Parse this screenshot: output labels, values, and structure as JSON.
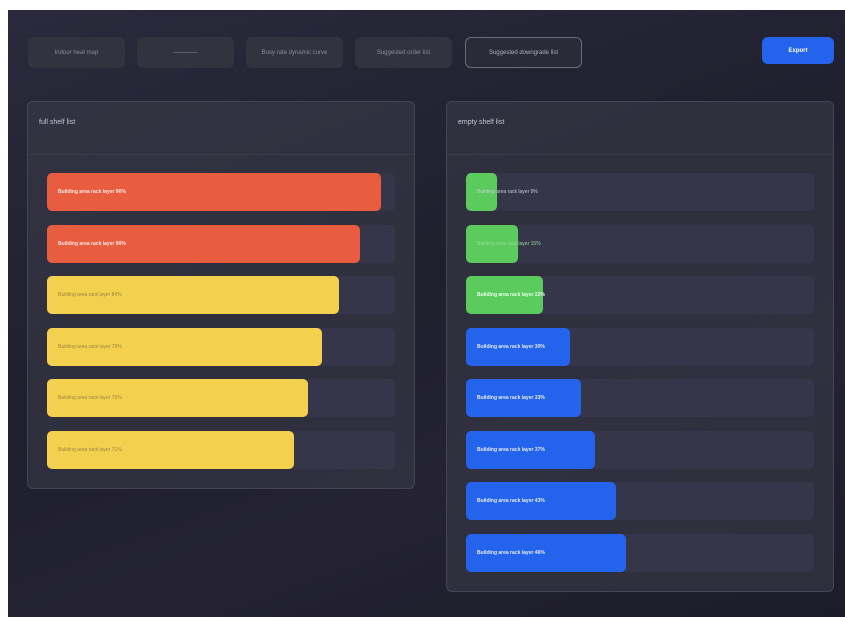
{
  "tabs": [
    {
      "label": "Indoor heat map",
      "active": false
    },
    {
      "label": "————",
      "active": false
    },
    {
      "label": "Busy rate dynamic curve",
      "active": false
    },
    {
      "label": "Suggested order list",
      "active": false
    },
    {
      "label": "Suggested downgrade list",
      "active": true
    }
  ],
  "export_label": "Export",
  "panels": {
    "full": {
      "title": "full shelf list",
      "rows": [
        {
          "label": "Building area rack layer 96%",
          "value": 96,
          "color": "#e85d3f",
          "text_color": "#ffe9e0",
          "bold": true
        },
        {
          "label": "Building area rack layer 90%",
          "value": 90,
          "color": "#e85d3f",
          "text_color": "#ffe9e0",
          "bold": true
        },
        {
          "label": "Building area rack layer 84%",
          "value": 84,
          "color": "#f4d04f",
          "text_color": "#9a8640",
          "bold": false
        },
        {
          "label": "Building area rack layer 79%",
          "value": 79,
          "color": "#f4d04f",
          "text_color": "#9a8640",
          "bold": false
        },
        {
          "label": "Building area rack layer 75%",
          "value": 75,
          "color": "#f4d04f",
          "text_color": "#9a8640",
          "bold": false
        },
        {
          "label": "Building area rack layer 71%",
          "value": 71,
          "color": "#f4d04f",
          "text_color": "#9a8640",
          "bold": false
        }
      ]
    },
    "empty": {
      "title": "empty shelf list",
      "rows": [
        {
          "label": "Building area rack layer 9%",
          "value": 9,
          "color": "#5bcb5d",
          "text_color": "#c9ccd8",
          "bold": false
        },
        {
          "label": "Building area rack layer 15%",
          "value": 15,
          "color": "#5bcb5d",
          "text_color": "#9bd89c",
          "bold": false
        },
        {
          "label": "Building area rack layer 22%",
          "value": 22,
          "color": "#5bcb5d",
          "text_color": "#eaffea",
          "bold": true
        },
        {
          "label": "Building area rack layer 30%",
          "value": 30,
          "color": "#2463eb",
          "text_color": "#e6ecff",
          "bold": true
        },
        {
          "label": "Building area rack layer 33%",
          "value": 33,
          "color": "#2463eb",
          "text_color": "#e6ecff",
          "bold": true
        },
        {
          "label": "Building area rack layer 37%",
          "value": 37,
          "color": "#2463eb",
          "text_color": "#e6ecff",
          "bold": true
        },
        {
          "label": "Building area rack layer 43%",
          "value": 43,
          "color": "#2463eb",
          "text_color": "#e6ecff",
          "bold": true
        },
        {
          "label": "Building area rack layer 46%",
          "value": 46,
          "color": "#2463eb",
          "text_color": "#e6ecff",
          "bold": true
        }
      ]
    }
  }
}
